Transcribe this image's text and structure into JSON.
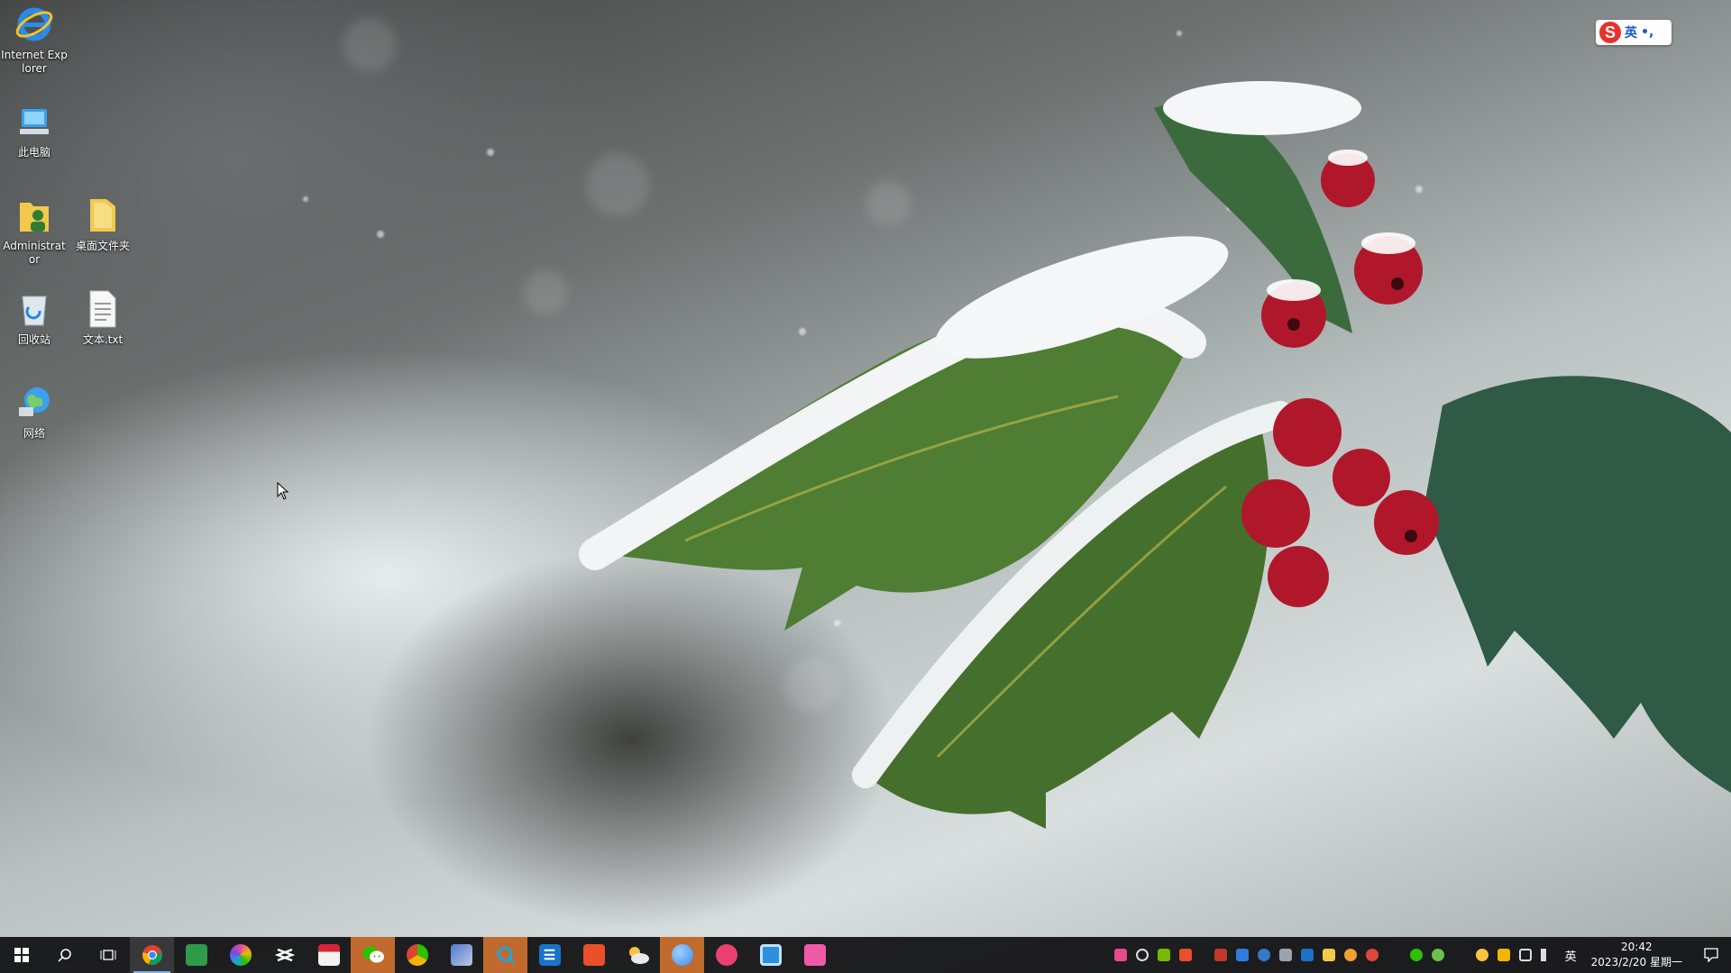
{
  "desktop": {
    "icons": [
      {
        "label": "Internet Explorer",
        "icon": "internet-explorer-icon"
      },
      {
        "label": "此电脑",
        "icon": "this-pc-icon"
      },
      {
        "label": "Administrator",
        "icon": "user-folder-icon"
      },
      {
        "label": "桌面文件夹",
        "icon": "folder-icon"
      },
      {
        "label": "回收站",
        "icon": "recycle-bin-icon"
      },
      {
        "label": "文本.txt",
        "icon": "text-file-icon"
      },
      {
        "label": "网络",
        "icon": "network-icon"
      }
    ]
  },
  "ime_badge": {
    "logo": "S",
    "lang": "英",
    "punct": "•,"
  },
  "taskbar": {
    "apps": [
      {
        "name": "chrome",
        "color": "#e8453c"
      },
      {
        "name": "spreadsheet-editor",
        "color": "#2e9b4a"
      },
      {
        "name": "color-picker",
        "color": "#e24aa0"
      },
      {
        "name": "capcut",
        "color": "#ffffff"
      },
      {
        "name": "calendar-app",
        "color": "#d8243a"
      },
      {
        "name": "wechat",
        "color": "#2dc100"
      },
      {
        "name": "browser-app",
        "color": "#f2b705"
      },
      {
        "name": "system-tool",
        "color": "#4b7bd6"
      },
      {
        "name": "search-tool",
        "color": "#1aa6e0"
      },
      {
        "name": "editor-e",
        "color": "#1a73c8"
      },
      {
        "name": "video-player",
        "color": "#e8502b"
      },
      {
        "name": "weather",
        "color": "#f6c343"
      },
      {
        "name": "globe-browser",
        "color": "#3a8ee6"
      },
      {
        "name": "music-app",
        "color": "#ea3f6f"
      },
      {
        "name": "window-app",
        "color": "#2e8fe0"
      },
      {
        "name": "media-app",
        "color": "#ef5aa8"
      }
    ],
    "tray": {
      "ime_indicator": "英",
      "time": "20:42",
      "date": "2023/2/20 星期一"
    }
  }
}
